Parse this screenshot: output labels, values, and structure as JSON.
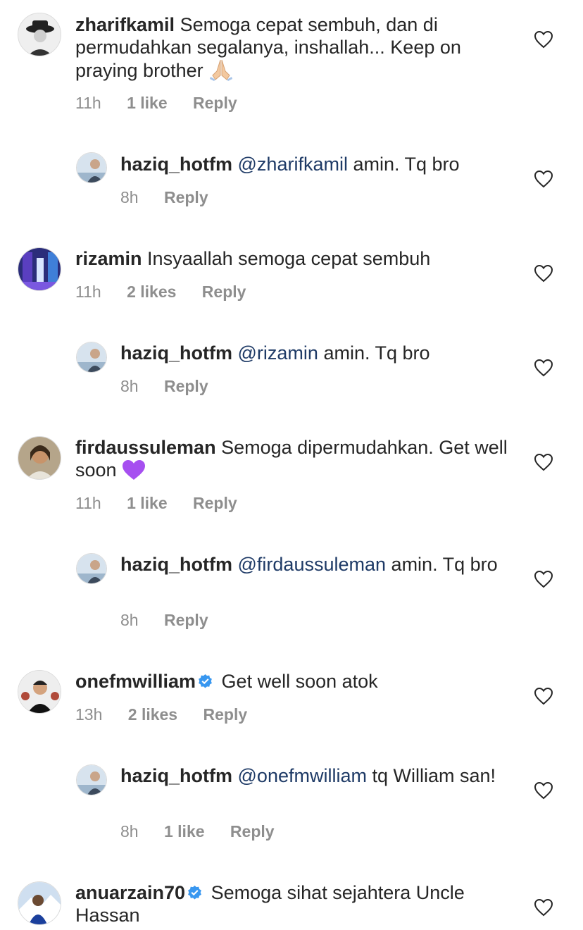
{
  "comments": [
    {
      "user": "zharifkamil",
      "text": "Semoga cepat sembuh, dan di permudahkan segalanya, inshallah... Keep on praying brother",
      "emoji": "praying-hands",
      "time": "11h",
      "likes": "1 like",
      "reply": "Reply"
    },
    {
      "user": "haziq_hotfm",
      "mention": "@zharifkamil",
      "text": "amin. Tq bro",
      "time": "8h",
      "reply": "Reply"
    },
    {
      "user": "rizamin",
      "text": "Insyaallah semoga cepat sembuh",
      "time": "11h",
      "likes": "2 likes",
      "reply": "Reply"
    },
    {
      "user": "haziq_hotfm",
      "mention": "@rizamin",
      "text": "amin. Tq bro",
      "time": "8h",
      "reply": "Reply"
    },
    {
      "user": "firdaussuleman",
      "text": "Semoga dipermudahkan. Get well soon",
      "emoji": "purple-heart",
      "time": "11h",
      "likes": "1 like",
      "reply": "Reply"
    },
    {
      "user": "haziq_hotfm",
      "mention": "@firdaussuleman",
      "text": "amin. Tq bro",
      "time": "8h",
      "reply": "Reply"
    },
    {
      "user": "onefmwilliam",
      "verified": true,
      "text": "Get well soon atok",
      "time": "13h",
      "likes": "2 likes",
      "reply": "Reply"
    },
    {
      "user": "haziq_hotfm",
      "mention": "@onefmwilliam",
      "text": "tq William san!",
      "time": "8h",
      "likes": "1 like",
      "reply": "Reply"
    },
    {
      "user": "anuarzain70",
      "verified": true,
      "text": "Semoga sihat sejahtera Uncle Hassan"
    }
  ],
  "colors": {
    "text": "#262626",
    "meta": "#8e8e8e",
    "mention": "#1e3a66",
    "verified": "#3897f0"
  },
  "icons": {
    "like": "heart-outline-icon",
    "verified": "verified-badge-icon"
  }
}
